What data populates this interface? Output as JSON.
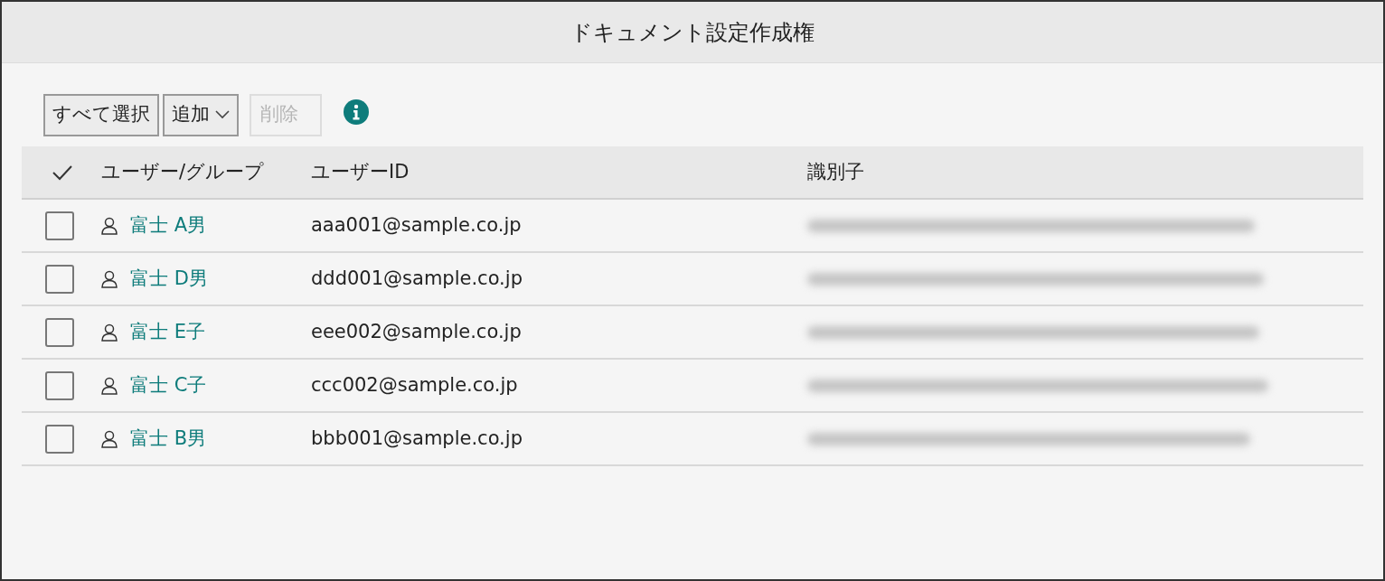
{
  "window": {
    "title": "ドキュメント設定作成権"
  },
  "toolbar": {
    "buttons": [
      {
        "label": "すべて選択",
        "kind": "plain",
        "disabled": false
      },
      {
        "label": "追加",
        "kind": "dropdown",
        "disabled": false
      },
      {
        "label": "削除",
        "kind": "plain",
        "disabled": true
      }
    ]
  },
  "table": {
    "columns": [
      "ユーザー/グループ",
      "ユーザーID",
      "識別子"
    ],
    "rows": [
      {
        "checked": false,
        "name": "富士 A男",
        "user_id": "aaa001@sample.co.jp"
      },
      {
        "checked": false,
        "name": "富士 D男",
        "user_id": "ddd001@sample.co.jp"
      },
      {
        "checked": false,
        "name": "富士 E子",
        "user_id": "eee002@sample.co.jp"
      },
      {
        "checked": false,
        "name": "富士 C子",
        "user_id": "ccc002@sample.co.jp"
      },
      {
        "checked": false,
        "name": "富士 B男",
        "user_id": "bbb001@sample.co.jp"
      }
    ]
  }
}
